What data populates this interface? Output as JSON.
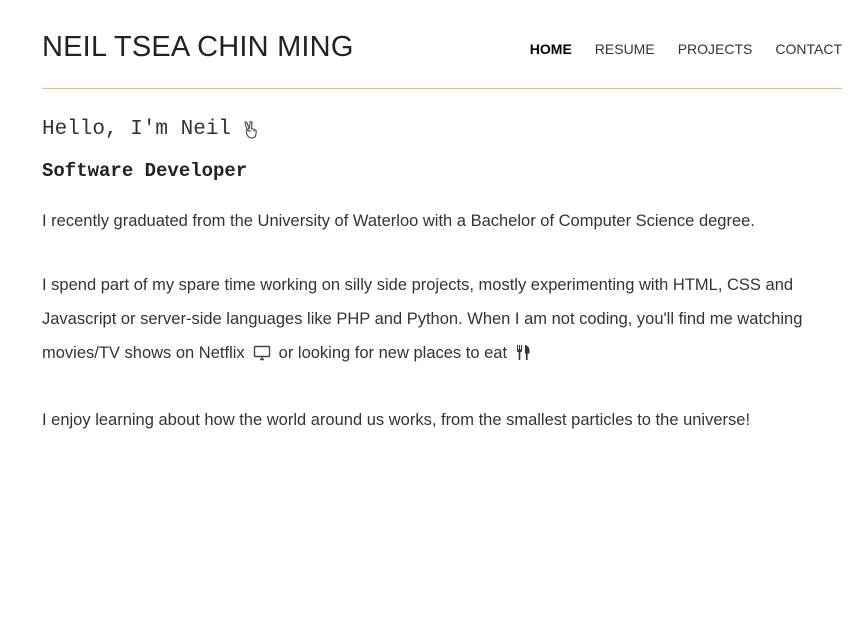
{
  "header": {
    "site_title": "NEIL TSEA CHIN MING",
    "nav": [
      {
        "label": "HOME",
        "active": true
      },
      {
        "label": "RESUME",
        "active": false
      },
      {
        "label": "PROJECTS",
        "active": false
      },
      {
        "label": "CONTACT",
        "active": false
      }
    ],
    "divider_color": "#f0b86a"
  },
  "main": {
    "greeting": "Hello, I'm Neil",
    "greeting_icon": "victory-hand-icon",
    "role": "Software Developer",
    "paragraph_1": "I recently graduated from the University of Waterloo with a Bachelor of Computer Science degree.",
    "paragraph_2": {
      "part_1": "I spend part of my spare time working on silly side projects, mostly experimenting with HTML, CSS and Javascript or server-side languages like PHP and Python. When I am not coding, you'll find me watching movies/TV shows on Netflix",
      "icon_1": "monitor-icon",
      "part_2": "or looking for new places to eat",
      "icon_2": "fork-knife-icon"
    },
    "paragraph_3": "I enjoy learning about how the world around us works, from the smallest particles to the universe!"
  }
}
